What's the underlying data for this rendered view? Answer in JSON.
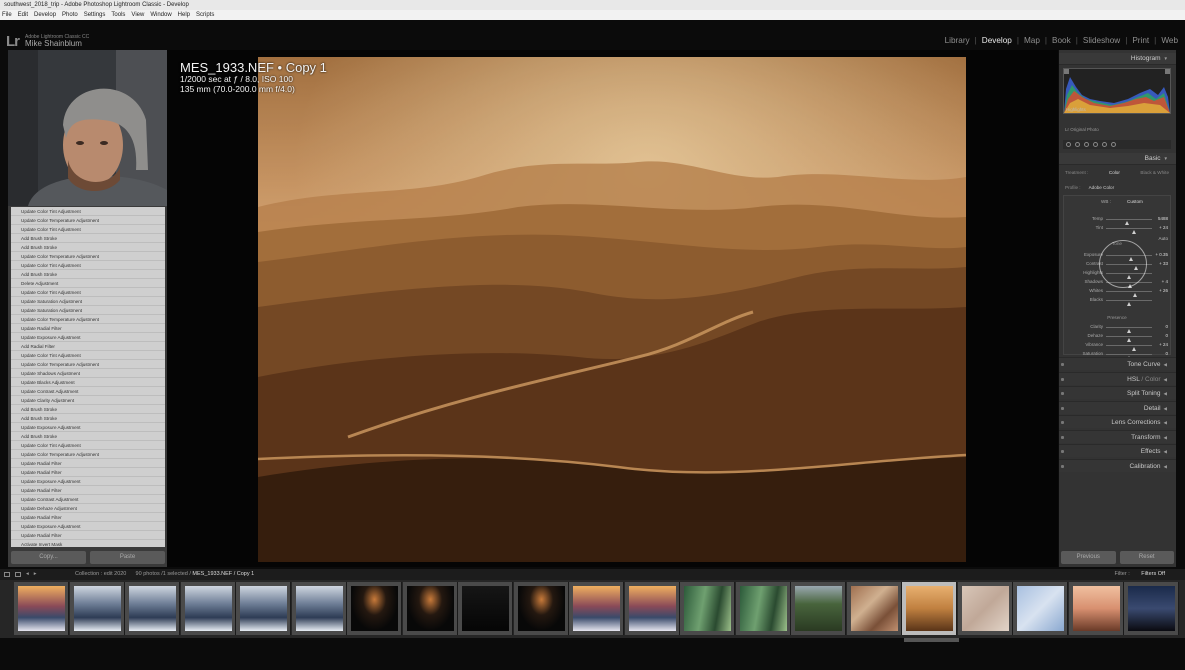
{
  "window": {
    "title": "southwest_2018_trip - Adobe Photoshop Lightroom Classic - Develop",
    "menu": [
      "File",
      "Edit",
      "Develop",
      "Photo",
      "Settings",
      "Tools",
      "View",
      "Window",
      "Help",
      "Scripts"
    ]
  },
  "identity": {
    "logo": "Lr",
    "subtitle": "Adobe Lightroom Classic CC",
    "name": "Mike Shainblum"
  },
  "modules": [
    {
      "label": "Library",
      "active": false
    },
    {
      "label": "Develop",
      "active": true
    },
    {
      "label": "Map",
      "active": false
    },
    {
      "label": "Book",
      "active": false
    },
    {
      "label": "Slideshow",
      "active": false
    },
    {
      "label": "Print",
      "active": false
    },
    {
      "label": "Web",
      "active": false
    }
  ],
  "history": [
    "Update Color Tint Adjustment",
    "Update Color Temperature Adjustment",
    "Update Color Tint Adjustment",
    "Add Brush Stroke",
    "Add Brush Stroke",
    "Update Color Temperature Adjustment",
    "Update Color Tint Adjustment",
    "Add Brush Stroke",
    "Delete Adjustment",
    "Update Color Tint Adjustment",
    "Update Saturation Adjustment",
    "Update Saturation Adjustment",
    "Update Color Temperature Adjustment",
    "Update Radial Filter",
    "Update Exposure Adjustment",
    "Add Radial Filter",
    "Update Color Tint Adjustment",
    "Update Color Temperature Adjustment",
    "Update Shadows Adjustment",
    "Update Blacks Adjustment",
    "Update Contrast Adjustment",
    "Update Clarity Adjustment",
    "Add Brush Stroke",
    "Add Brush Stroke",
    "Update Exposure Adjustment",
    "Add Brush Stroke",
    "Update Color Tint Adjustment",
    "Update Color Temperature Adjustment",
    "Update Radial Filter",
    "Update Radial Filter",
    "Update Exposure Adjustment",
    "Update Radial Filter",
    "Update Contrast Adjustment",
    "Update Dehaze Adjustment",
    "Update Radial Filter",
    "Update Exposure Adjustment",
    "Update Radial Filter",
    "Activate Invert Mask"
  ],
  "left_buttons": {
    "copy": "Copy...",
    "paste": "Paste"
  },
  "photo_info": {
    "title": "MES_1933.NEF • Copy 1",
    "line2": "1/2000 sec at ƒ / 8.0, ISO 100",
    "line3": "135 mm (70.0-200.0 mm f/4.0)"
  },
  "right_panel": {
    "histogram_label": "Histogram",
    "highlights_label": "Highlights",
    "original_photo": "Lr Original Photo",
    "basic_label": "Basic",
    "treatment_label": "Treatment :",
    "treatment_color": "Color",
    "treatment_bw": "Black & White",
    "profile_label": "Profile :",
    "profile_value": "Adobe Color",
    "wb_label": "WB :",
    "wb_value": "Custom",
    "tone_label": "Tone",
    "auto_label": "Auto",
    "presence_label": "Presence",
    "sliders_wb": [
      {
        "label": "Temp",
        "value": "5488",
        "pos": 0.45
      },
      {
        "label": "Tint",
        "value": "+ 24",
        "pos": 0.6
      }
    ],
    "sliders_tone": [
      {
        "label": "Exposure",
        "value": "+ 0.35",
        "pos": 0.55
      },
      {
        "label": "Contrast",
        "value": "+ 33",
        "pos": 0.65
      },
      {
        "label": "Highlights",
        "value": "",
        "pos": 0.5
      },
      {
        "label": "Shadows",
        "value": "+ 4",
        "pos": 0.52
      },
      {
        "label": "Whites",
        "value": "+ 26",
        "pos": 0.62
      },
      {
        "label": "Blacks",
        "value": "",
        "pos": 0.5
      }
    ],
    "sliders_presence": [
      {
        "label": "Clarity",
        "value": "0",
        "pos": 0.5
      },
      {
        "label": "Dehaze",
        "value": "0",
        "pos": 0.5
      },
      {
        "label": "Vibrance",
        "value": "+ 24",
        "pos": 0.6
      },
      {
        "label": "Saturation",
        "value": "0",
        "pos": 0.5
      }
    ],
    "collapsed_panels": [
      {
        "label": "Tone Curve",
        "dim": ""
      },
      {
        "label": "HSL",
        "dim": " / Color"
      },
      {
        "label": "Split Toning",
        "dim": ""
      },
      {
        "label": "Detail",
        "dim": ""
      },
      {
        "label": "Lens Corrections",
        "dim": ""
      },
      {
        "label": "Transform",
        "dim": ""
      },
      {
        "label": "Effects",
        "dim": ""
      },
      {
        "label": "Calibration",
        "dim": ""
      }
    ],
    "previous": "Previous",
    "reset": "Reset"
  },
  "filmstrip_bar": {
    "collection": "Collection : edit 2020",
    "count": "90 photos /1 selected /",
    "current": "MES_1933.NEF / Copy 1",
    "filter_label": "Filter :",
    "filter_value": "Filters Off"
  },
  "filmstrip": [
    {
      "tone": "sunset-waterfall",
      "selected": false
    },
    {
      "tone": "misty-waterfall",
      "selected": false
    },
    {
      "tone": "misty-waterfall",
      "selected": false
    },
    {
      "tone": "misty-waterfall",
      "selected": false
    },
    {
      "tone": "misty-waterfall",
      "selected": false
    },
    {
      "tone": "misty-waterfall",
      "selected": false
    },
    {
      "tone": "dark-sunset",
      "selected": false
    },
    {
      "tone": "dark-sunset",
      "selected": false
    },
    {
      "tone": "dark",
      "selected": false
    },
    {
      "tone": "dark-sunset",
      "selected": false
    },
    {
      "tone": "sunset-waterfall",
      "selected": false
    },
    {
      "tone": "sunset-waterfall",
      "selected": false
    },
    {
      "tone": "green-forest",
      "selected": false
    },
    {
      "tone": "green-forest",
      "selected": false
    },
    {
      "tone": "green-mountains",
      "selected": false
    },
    {
      "tone": "aerial-brown",
      "selected": false
    },
    {
      "tone": "golden-dunes",
      "selected": true
    },
    {
      "tone": "cracked-earth",
      "selected": false
    },
    {
      "tone": "blue-cracked",
      "selected": false
    },
    {
      "tone": "dune-pink",
      "selected": false
    },
    {
      "tone": "night-tree",
      "selected": false
    }
  ]
}
